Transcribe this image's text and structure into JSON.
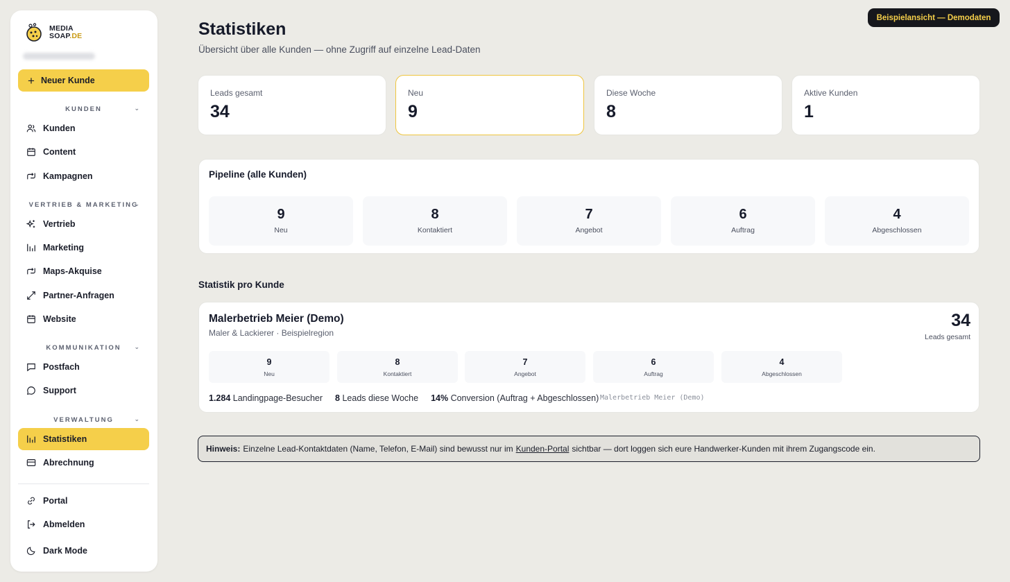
{
  "brand": {
    "line1": "MEDIA",
    "line2": "SOAP",
    "line2_suffix": ".DE"
  },
  "sidebar": {
    "new_customer": "Neuer Kunde",
    "sections": [
      {
        "label": "KUNDEN",
        "items": [
          "Kunden",
          "Content",
          "Kampagnen"
        ]
      },
      {
        "label": "VERTRIEB & MARKETING",
        "items": [
          "Vertrieb",
          "Marketing",
          "Maps-Akquise",
          "Partner-Anfragen",
          "Website"
        ]
      },
      {
        "label": "KOMMUNIKATION",
        "items": [
          "Postfach",
          "Support"
        ]
      },
      {
        "label": "VERWALTUNG",
        "items": [
          "Statistiken",
          "Abrechnung"
        ]
      }
    ],
    "footer": [
      "Portal",
      "Abmelden",
      "Dark Mode"
    ],
    "active_item": "Statistiken"
  },
  "header": {
    "badge": "Beispielansicht — Demodaten",
    "title": "Statistiken",
    "subtitle": "Übersicht über alle Kunden — ohne Zugriff auf einzelne Lead-Daten"
  },
  "kpis": [
    {
      "label": "Leads gesamt",
      "value": "34"
    },
    {
      "label": "Neu",
      "value": "9"
    },
    {
      "label": "Diese Woche",
      "value": "8"
    },
    {
      "label": "Aktive Kunden",
      "value": "1"
    }
  ],
  "pipeline": {
    "title": "Pipeline (alle Kunden)",
    "stages": [
      {
        "value": "9",
        "label": "Neu"
      },
      {
        "value": "8",
        "label": "Kontaktiert"
      },
      {
        "value": "7",
        "label": "Angebot"
      },
      {
        "value": "6",
        "label": "Auftrag"
      },
      {
        "value": "4",
        "label": "Abgeschlossen"
      }
    ]
  },
  "per_customer": {
    "section_title": "Statistik pro Kunde",
    "customer": {
      "name": "Malerbetrieb Meier (Demo)",
      "subtitle": "Maler & Lackierer · Beispielregion",
      "total": "34",
      "total_label": "Leads gesamt",
      "stages": [
        {
          "value": "9",
          "label": "Neu"
        },
        {
          "value": "8",
          "label": "Kontaktiert"
        },
        {
          "value": "7",
          "label": "Angebot"
        },
        {
          "value": "6",
          "label": "Auftrag"
        },
        {
          "value": "4",
          "label": "Abgeschlossen"
        }
      ],
      "visitors_value": "1.284",
      "visitors_label": "Landingpage-Besucher",
      "week_value": "8",
      "week_label": "Leads diese Woche",
      "conversion_value": "14%",
      "conversion_label": "Conversion (Auftrag + Abgeschlossen)",
      "mono_label": "Malerbetrieb Meier (Demo)"
    }
  },
  "hint": {
    "prefix": "Hinweis:",
    "text_before": "Einzelne Lead-Kontaktdaten (Name, Telefon, E-Mail) sind bewusst nur im",
    "link": "Kunden-Portal",
    "text_after": "sichtbar — dort loggen sich eure Handwerker-Kunden mit ihrem Zugangscode ein."
  },
  "colors": {
    "accent": "#f5cf4a",
    "badge_bg": "#16171c",
    "background": "#ecebe6"
  }
}
